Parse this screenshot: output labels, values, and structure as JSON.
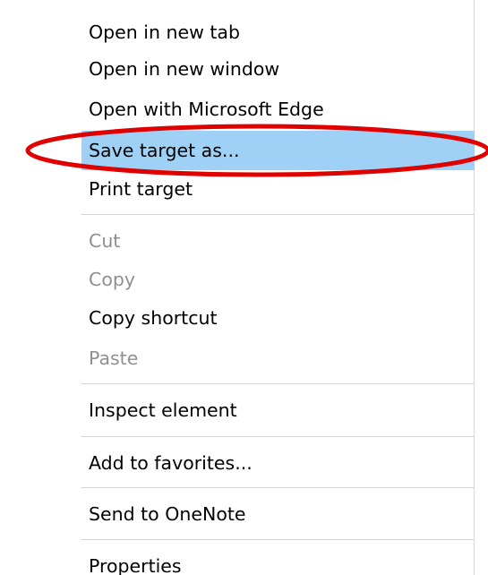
{
  "menu": {
    "items": [
      {
        "label": "Open in new tab",
        "disabled": false,
        "highlighted": false
      },
      {
        "label": "Open in new window",
        "disabled": false,
        "highlighted": false
      },
      {
        "label": "Open with Microsoft Edge",
        "disabled": false,
        "highlighted": false
      },
      {
        "label": "Save target as...",
        "disabled": false,
        "highlighted": true
      },
      {
        "label": "Print target",
        "disabled": false,
        "highlighted": false
      },
      {
        "label": "Cut",
        "disabled": true,
        "highlighted": false
      },
      {
        "label": "Copy",
        "disabled": true,
        "highlighted": false
      },
      {
        "label": "Copy shortcut",
        "disabled": false,
        "highlighted": false
      },
      {
        "label": "Paste",
        "disabled": true,
        "highlighted": false
      },
      {
        "label": "Inspect element",
        "disabled": false,
        "highlighted": false
      },
      {
        "label": "Add to favorites...",
        "disabled": false,
        "highlighted": false
      },
      {
        "label": "Send to OneNote",
        "disabled": false,
        "highlighted": false
      },
      {
        "label": "Properties",
        "disabled": false,
        "highlighted": false
      }
    ]
  },
  "colors": {
    "highlight": "#9fd1f6",
    "annotation": "#e00000",
    "disabled_text": "#8f8f8f",
    "separator": "#d6d6d6"
  }
}
